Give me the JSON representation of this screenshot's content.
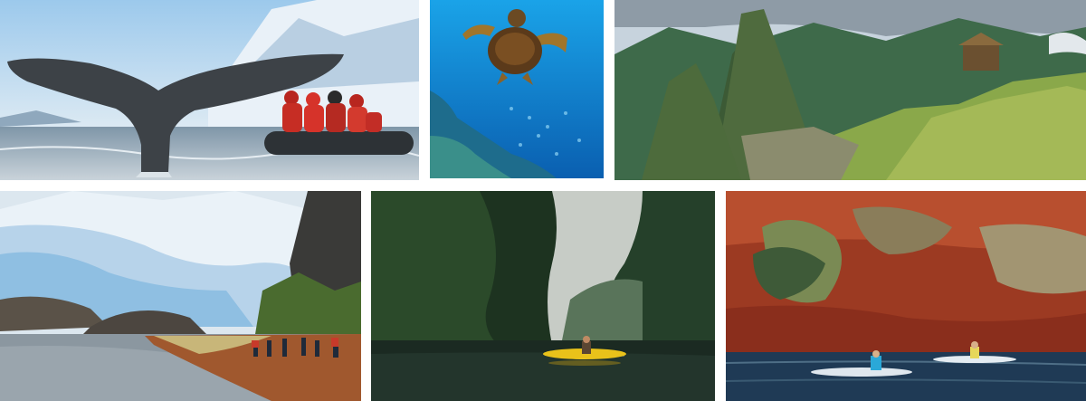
{
  "collage": {
    "photos": [
      {
        "subject": "whale-tail-zodiac"
      },
      {
        "subject": "sea-turtle-reef"
      },
      {
        "subject": "machu-picchu"
      },
      {
        "subject": "glacier-shore-hikers"
      },
      {
        "subject": "jungle-river-kayak"
      },
      {
        "subject": "red-cliff-kayakers"
      }
    ]
  }
}
